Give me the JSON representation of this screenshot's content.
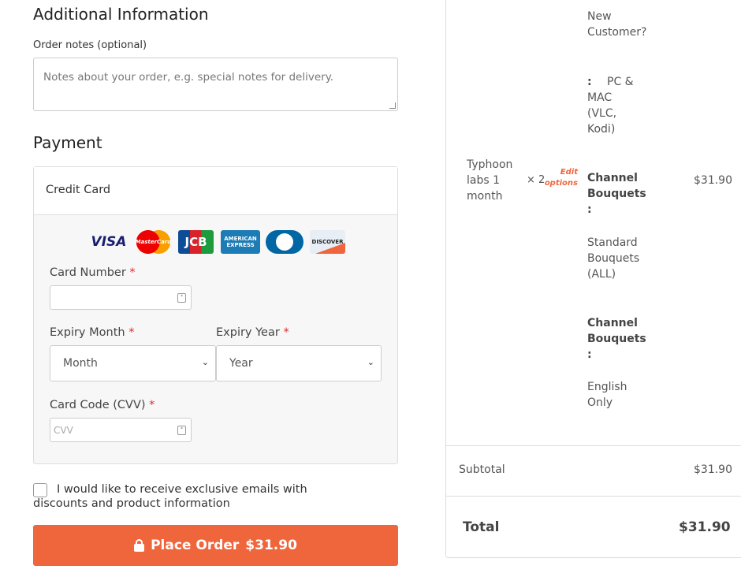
{
  "additional": {
    "title": "Additional Information",
    "notes_label": "Order notes (optional)",
    "notes_placeholder": "Notes about your order, e.g. special notes for delivery."
  },
  "payment": {
    "title": "Payment",
    "method": "Credit Card",
    "card_logos": [
      "VISA",
      "MasterCard",
      "JCB",
      "AMERICAN EXPRESS",
      "Diners Club",
      "DISCOVER"
    ],
    "card_number_label": "Card Number",
    "expiry_month_label": "Expiry Month",
    "expiry_month_value": "Month",
    "expiry_year_label": "Expiry Year",
    "expiry_year_value": "Year",
    "cvv_label": "Card Code (CVV)",
    "cvv_placeholder": "CVV",
    "required": "*"
  },
  "newsletter": {
    "label": "I would like to receive exclusive emails with discounts and product information",
    "checked": false
  },
  "place_order": {
    "label": "Place Order",
    "amount": "$31.90"
  },
  "summary": {
    "meta_top": "New Customer?",
    "meta_colon": ":",
    "meta_device": "PC & MAC (VLC, Kodi)",
    "item": {
      "name": "Typhoon labs 1 month",
      "qty": "× 2",
      "edit": "Edit options",
      "price": "$31.90"
    },
    "options": [
      {
        "key": "Channel Bouquets",
        "sep": ":",
        "value": "Standard Bouquets (ALL)"
      },
      {
        "key": "Channel Bouquets",
        "sep": ":",
        "value": "English Only"
      }
    ],
    "subtotal_label": "Subtotal",
    "subtotal": "$31.90",
    "total_label": "Total",
    "total": "$31.90"
  },
  "colors": {
    "accent": "#f0663c",
    "required": "#e02b2b"
  }
}
